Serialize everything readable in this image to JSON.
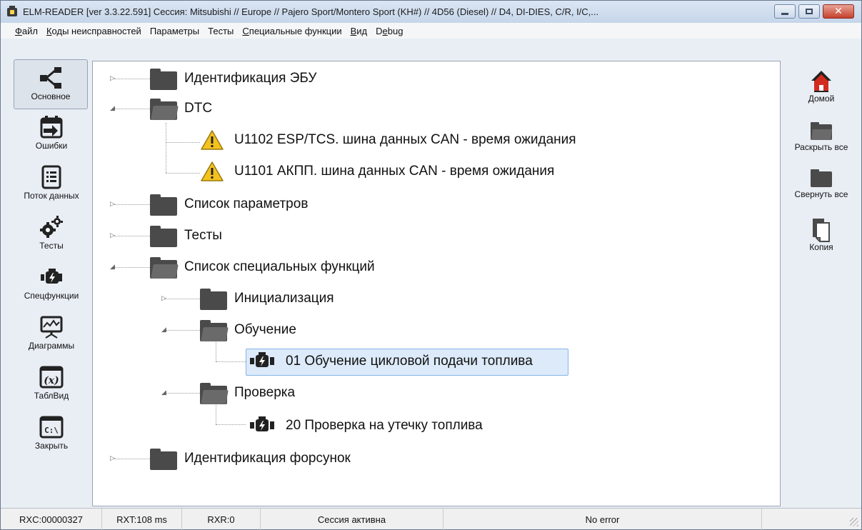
{
  "window": {
    "title": "ELM-READER [ver 3.3.22.591] Сессия: Mitsubishi // Europe // Pajero Sport/Montero Sport (KH#) // 4D56 (Diesel) // D4, DI-DIES, C/R, I/C,...",
    "icon": "app-engine-icon",
    "buttons": [
      "minimize",
      "maximize",
      "close"
    ]
  },
  "menu": [
    {
      "label": "Файл",
      "accel": "Ф",
      "rest": "айл"
    },
    {
      "label": "Коды неисправностей",
      "accel": "К",
      "rest": "оды неисправностей"
    },
    {
      "label": "Параметры",
      "accel": "",
      "rest": "Параметры"
    },
    {
      "label": "Тесты",
      "accel": "",
      "rest": "Тесты"
    },
    {
      "label": "Специальные функции",
      "accel": "С",
      "rest": "пециальные функции"
    },
    {
      "label": "Вид",
      "accel": "В",
      "rest": "ид"
    },
    {
      "label": "Debug",
      "accel": "",
      "rest": "D",
      "accel2": "e",
      "rest2": "bug"
    }
  ],
  "left_toolbar": [
    {
      "label": "Основное",
      "icon": "share-tree-icon",
      "active": true
    },
    {
      "label": "Ошибки",
      "icon": "calendar-import-icon",
      "active": false
    },
    {
      "label": "Поток данных",
      "icon": "document-list-icon",
      "active": false
    },
    {
      "label": "Тесты",
      "icon": "gears-icon",
      "active": false
    },
    {
      "label": "Спецфункции",
      "icon": "engine-icon",
      "active": false
    },
    {
      "label": "Диаграммы",
      "icon": "chart-monitor-icon",
      "active": false
    },
    {
      "label": "ТаблВид",
      "icon": "formula-x-icon",
      "active": false
    },
    {
      "label": "Закрыть",
      "icon": "console-icon",
      "active": false
    }
  ],
  "tree": [
    {
      "label": "Идентификация ЭБУ",
      "type": "folder",
      "level": 0,
      "expanded": false
    },
    {
      "label": "DTC",
      "type": "folder",
      "level": 0,
      "expanded": true
    },
    {
      "label": "U1102 ESP/TCS. шина данных CAN - время ожидания",
      "type": "warning",
      "level": 1
    },
    {
      "label": "U1101 АКПП. шина данных CAN - время ожидания",
      "type": "warning",
      "level": 1
    },
    {
      "label": "Список параметров",
      "type": "folder",
      "level": 0,
      "expanded": false
    },
    {
      "label": "Тесты",
      "type": "folder",
      "level": 0,
      "expanded": false
    },
    {
      "label": "Список специальных функций",
      "type": "folder",
      "level": 0,
      "expanded": true
    },
    {
      "label": "Инициализация",
      "type": "folder",
      "level": 1,
      "expanded": false
    },
    {
      "label": "Обучение",
      "type": "folder",
      "level": 1,
      "expanded": true
    },
    {
      "label": "01 Обучение цикловой подачи топлива",
      "type": "engine",
      "level": 2,
      "selected": true
    },
    {
      "label": "Проверка",
      "type": "folder",
      "level": 1,
      "expanded": true
    },
    {
      "label": "20 Проверка на утечку топлива",
      "type": "engine",
      "level": 2
    },
    {
      "label": "Идентификация форсунок",
      "type": "folder",
      "level": 0,
      "expanded": false
    }
  ],
  "right_toolbar": [
    {
      "label": "Домой",
      "icon": "home-icon"
    },
    {
      "label": "Раскрыть все",
      "icon": "folder-expand-icon"
    },
    {
      "label": "Свернуть все",
      "icon": "folder-collapse-icon"
    },
    {
      "label": "Копия",
      "icon": "copy-document-icon"
    }
  ],
  "status": {
    "rxc": "RXC:00000327",
    "rxt": "RXT:108 ms",
    "rxr": "RXR:0",
    "session": "Сессия активна",
    "error": "No error"
  },
  "colors": {
    "accent": "#dceaf9",
    "warning": "#f4c21c",
    "home": "#d42a1e"
  }
}
